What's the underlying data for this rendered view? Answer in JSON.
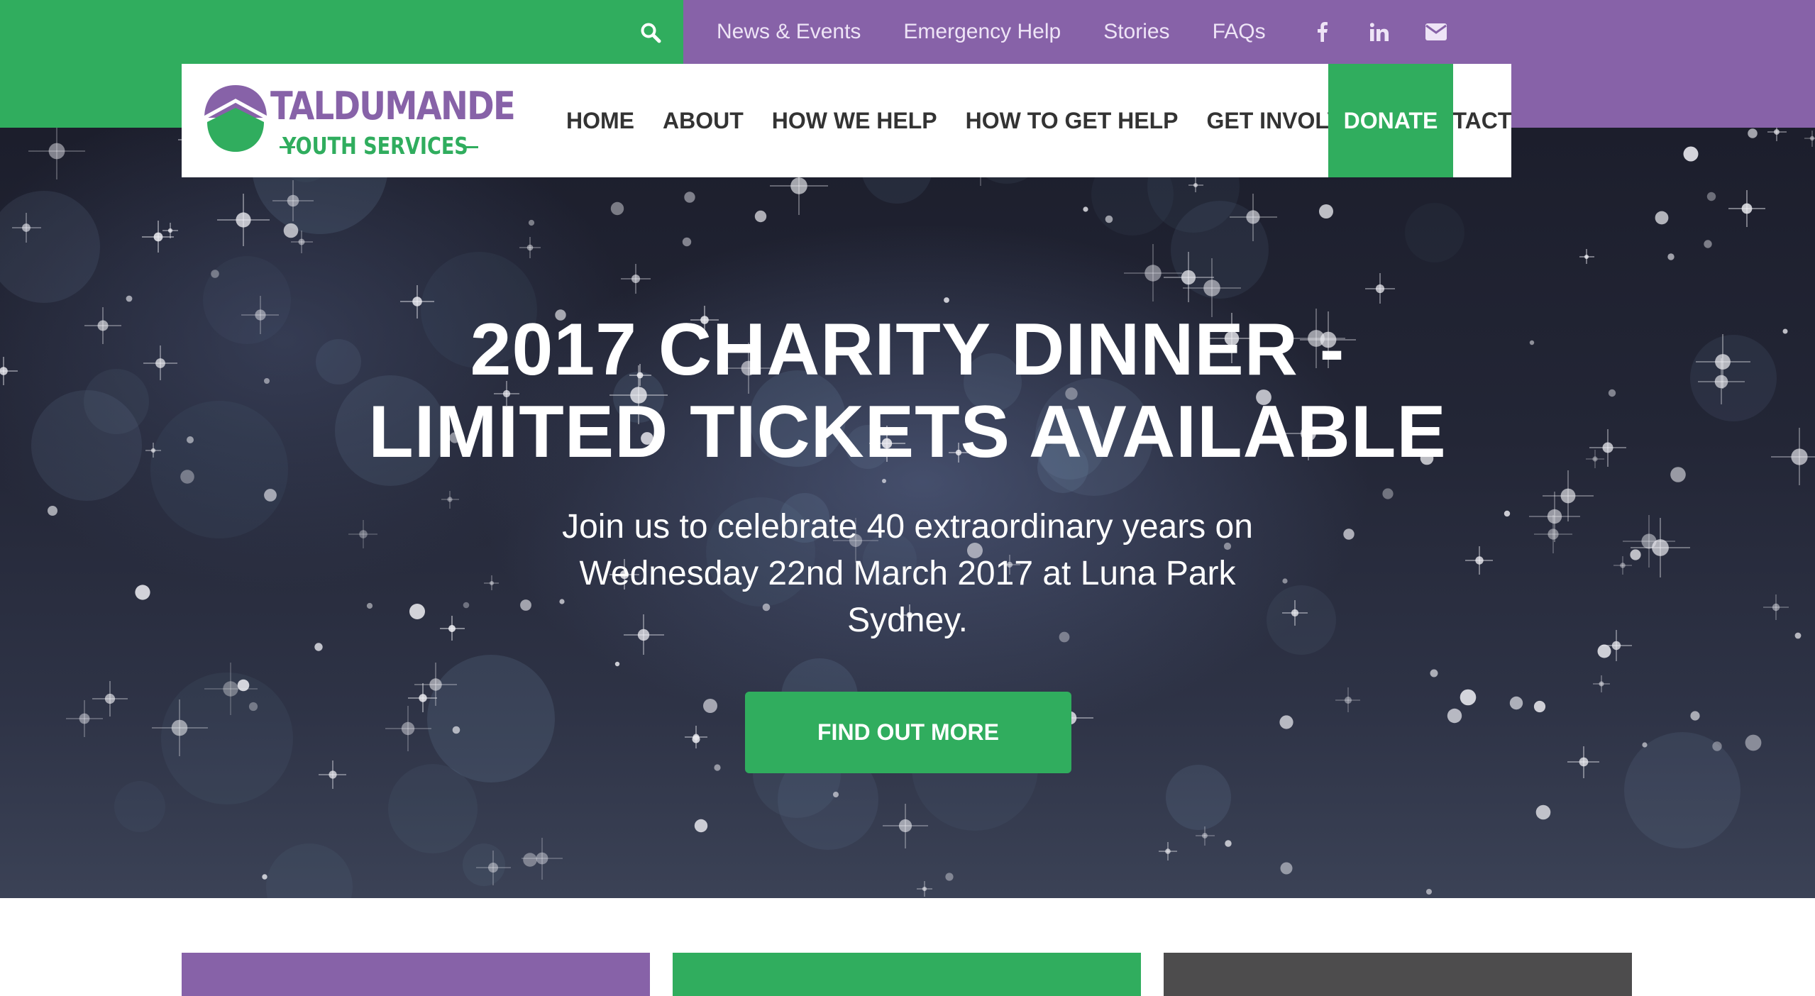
{
  "colors": {
    "green": "#30ad5e",
    "purple": "#8762a8",
    "dark_grey": "#4d4c4d"
  },
  "utility_nav": {
    "search_icon": "search-icon",
    "links": [
      "News & Events",
      "Emergency Help",
      "Stories",
      "FAQs"
    ],
    "social_icons": [
      "facebook-icon",
      "linkedin-icon",
      "envelope-icon"
    ]
  },
  "logo": {
    "line1": "TALDUMANDE",
    "line2": "YOUTH SERVICES"
  },
  "main_nav": {
    "items": [
      "HOME",
      "ABOUT",
      "HOW WE HELP",
      "HOW TO GET HELP",
      "GET INVOLVED",
      "CONTACT"
    ],
    "donate_label": "DONATE"
  },
  "hero": {
    "title_line1": "2017 CHARITY DINNER -",
    "title_line2": "LIMITED TICKETS AVAILABLE",
    "subtitle_line1": "Join us to celebrate 40 extraordinary years on",
    "subtitle_line2": "Wednesday 22nd March 2017 at Luna Park",
    "subtitle_line3": "Sydney.",
    "cta_label": "FIND OUT MORE"
  },
  "tiles": [
    "purple",
    "green",
    "dark-grey"
  ]
}
